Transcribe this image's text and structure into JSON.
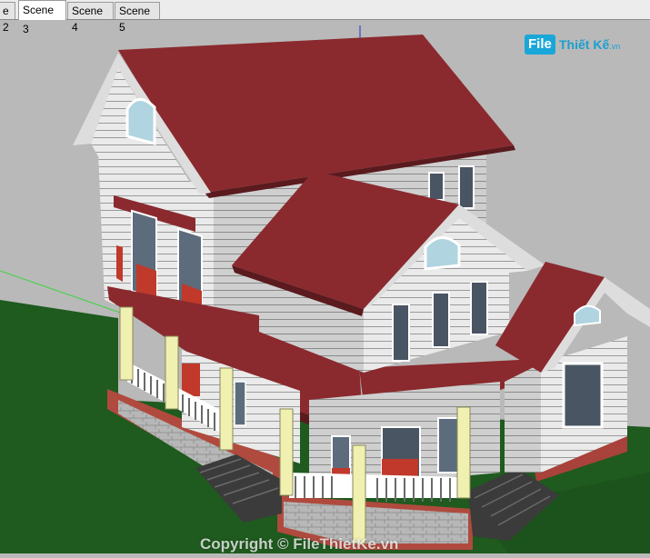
{
  "tabs": [
    {
      "label": "e 2",
      "active": false
    },
    {
      "label": "Scene 3",
      "active": true
    },
    {
      "label": "Scene 4",
      "active": false
    },
    {
      "label": "Scene 5",
      "active": false
    }
  ],
  "watermark": {
    "logo_file": "File",
    "logo_rest": "Thiết Kế",
    "logo_suffix": ".vn",
    "copyright": "Copyright © FileThietKe.vn"
  },
  "colors": {
    "sky": "#b9b9b9",
    "grass": "#1f5a1f",
    "roof": "#8a2a2e",
    "siding": "#e8e8e8",
    "column": "#f0f0b0",
    "accent": "#19a6d9"
  }
}
